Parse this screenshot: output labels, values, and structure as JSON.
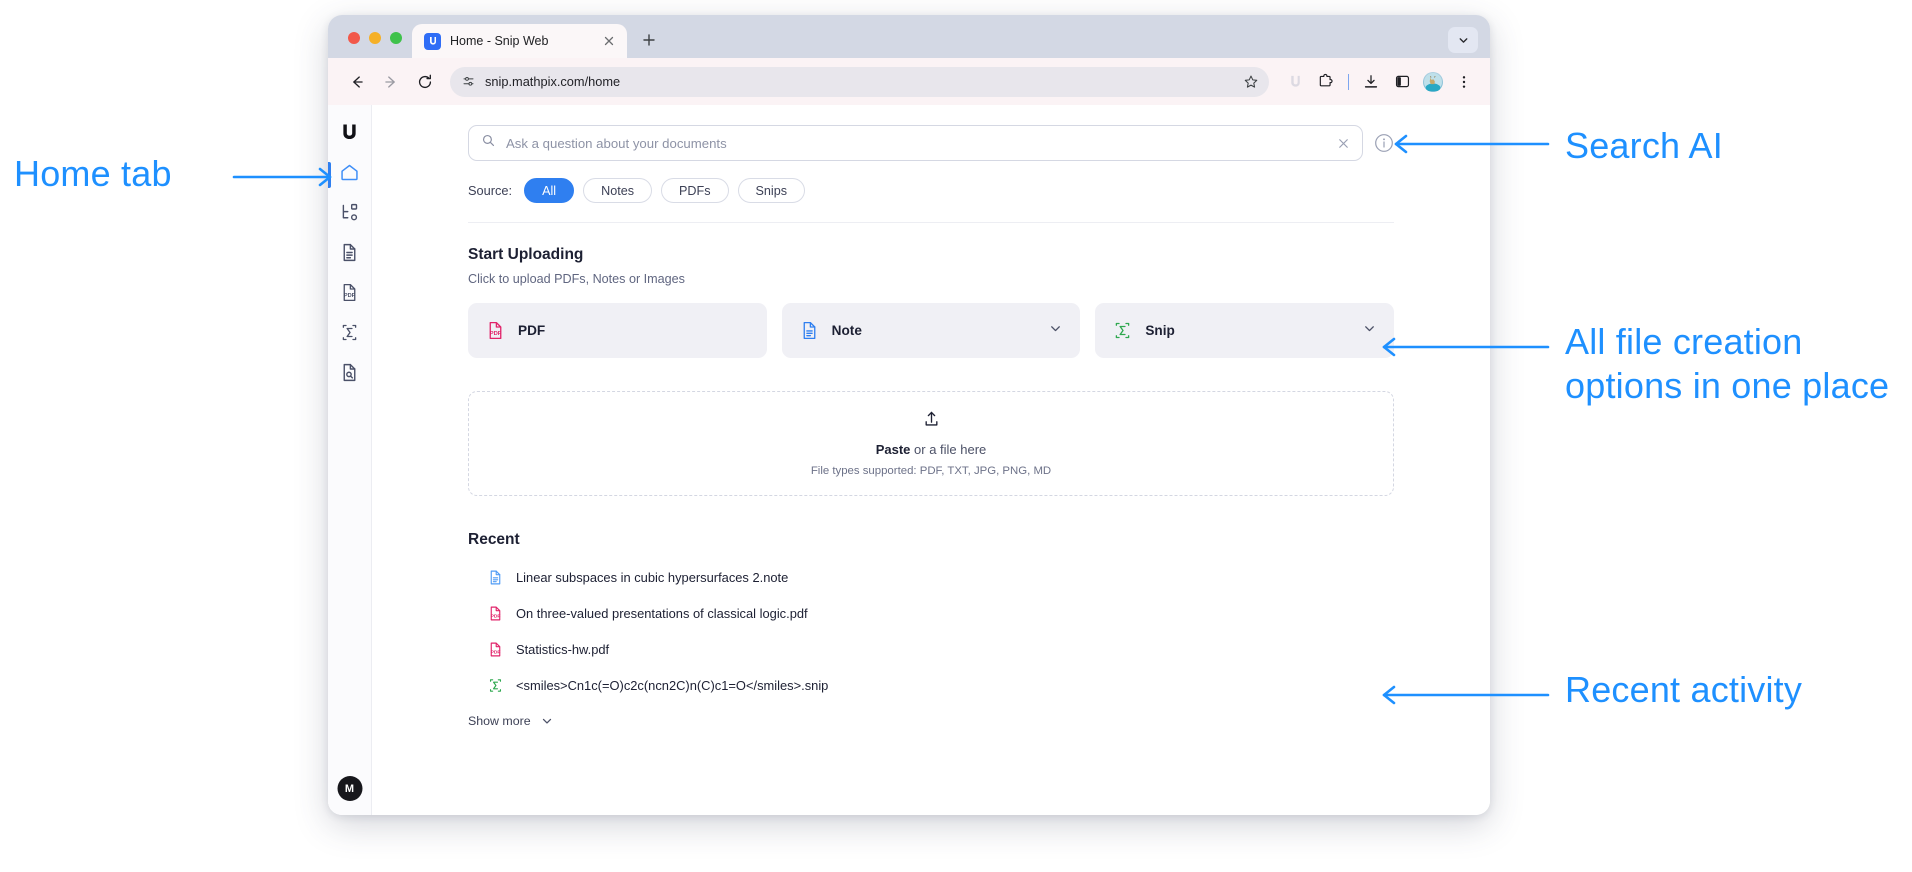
{
  "browser": {
    "tab": {
      "title": "Home - Snip Web",
      "favicon": "mathpix-favicon",
      "close_icon": "close-icon"
    },
    "new_tab_icon": "plus-icon",
    "tab_search_icon": "chevron-down-icon",
    "nav": {
      "back": "back-arrow-icon",
      "forward": "forward-arrow-icon",
      "reload": "reload-icon"
    },
    "omnibox": {
      "site_settings_icon": "tune-icon",
      "url": "snip.mathpix.com/home",
      "bookmark_icon": "star-icon"
    },
    "toolbar_icons": [
      "mathpix-extension-icon",
      "extensions-puzzle-icon",
      "downloads-icon",
      "side-panel-icon",
      "profile-avatar",
      "more-menu-icon"
    ]
  },
  "sidebar": {
    "logo": "mathpix-logo",
    "items": [
      {
        "name": "home",
        "icon": "home-icon",
        "active": true
      },
      {
        "name": "workspace",
        "icon": "tree-hierarchy-icon",
        "active": false
      },
      {
        "name": "notes",
        "icon": "document-icon",
        "active": false
      },
      {
        "name": "pdfs",
        "icon": "pdf-icon",
        "active": false
      },
      {
        "name": "snips",
        "icon": "sigma-snip-icon",
        "active": false
      },
      {
        "name": "search-documents",
        "icon": "document-search-icon",
        "active": false
      }
    ],
    "avatar": {
      "initial": "M"
    }
  },
  "search": {
    "icon": "search-icon",
    "placeholder": "Ask a question about your documents",
    "value": "",
    "clear_icon": "close-icon",
    "info_icon": "info-icon"
  },
  "source_filter": {
    "label": "Source:",
    "chips": [
      {
        "label": "All",
        "selected": true
      },
      {
        "label": "Notes",
        "selected": false
      },
      {
        "label": "PDFs",
        "selected": false
      },
      {
        "label": "Snips",
        "selected": false
      }
    ],
    "selected_color": "#2f7ff0"
  },
  "upload": {
    "title": "Start Uploading",
    "subtitle": "Click to upload PDFs, Notes or Images",
    "cards": [
      {
        "label": "PDF",
        "icon": "pdf-file-icon",
        "icon_color": "#e1236a",
        "has_chevron": false
      },
      {
        "label": "Note",
        "icon": "note-file-icon",
        "icon_color": "#2f7ff0",
        "has_chevron": true
      },
      {
        "label": "Snip",
        "icon": "snip-sigma-icon",
        "icon_color": "#2fa84f",
        "has_chevron": true
      }
    ],
    "dropzone": {
      "icon": "upload-icon",
      "action": "Paste",
      "rest": " or a file here",
      "types": "File types supported: PDF, TXT, JPG, PNG, MD"
    }
  },
  "recent": {
    "title": "Recent",
    "items": [
      {
        "name": "Linear subspaces in cubic hypersurfaces 2.note",
        "icon": "note-file-icon",
        "type": "note"
      },
      {
        "name": "On three-valued presentations of classical logic.pdf",
        "icon": "pdf-file-icon",
        "type": "pdf"
      },
      {
        "name": "Statistics-hw.pdf",
        "icon": "pdf-file-icon",
        "type": "pdf"
      },
      {
        "name": "<smiles>Cn1c(=O)c2c(ncn2C)n(C)c1=O</smiles>.snip",
        "icon": "snip-sigma-icon",
        "type": "snip"
      }
    ],
    "show_more": {
      "label": "Show more",
      "icon": "chevron-down-icon"
    }
  },
  "annotations": {
    "color": "#1e90ff",
    "home_tab": "Home tab",
    "search_ai": "Search AI",
    "file_creation": "All file creation options in one place",
    "recent_activity": "Recent activity"
  }
}
